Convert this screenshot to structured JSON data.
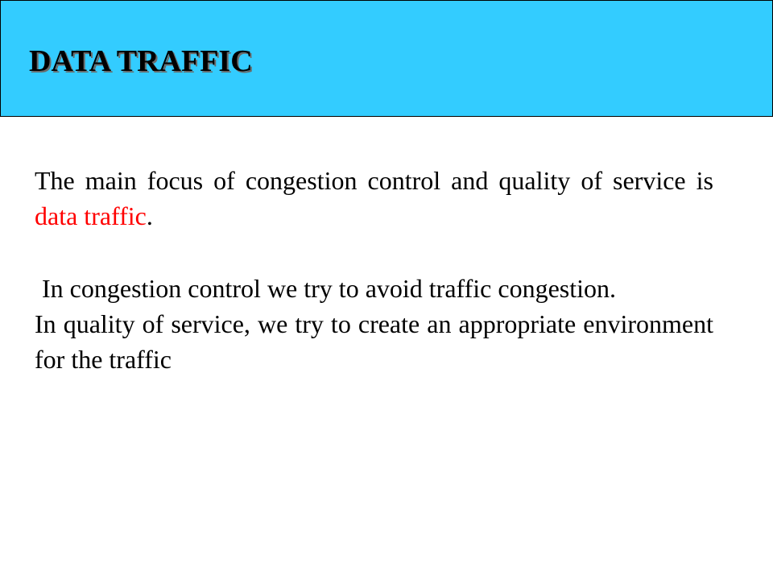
{
  "slide": {
    "title": "DATA TRAFFIC",
    "paragraph1": {
      "before": "The main focus of congestion control and quality of service is ",
      "highlight": "data traffic",
      "after": "."
    },
    "paragraph2": {
      "line1": "In congestion control we try to avoid traffic congestion.",
      "line2": "In quality of service, we try to create an appropriate environment for the traffic"
    }
  },
  "colors": {
    "title_bar": "#33ccff",
    "highlight": "#ff0000",
    "text": "#000000"
  }
}
